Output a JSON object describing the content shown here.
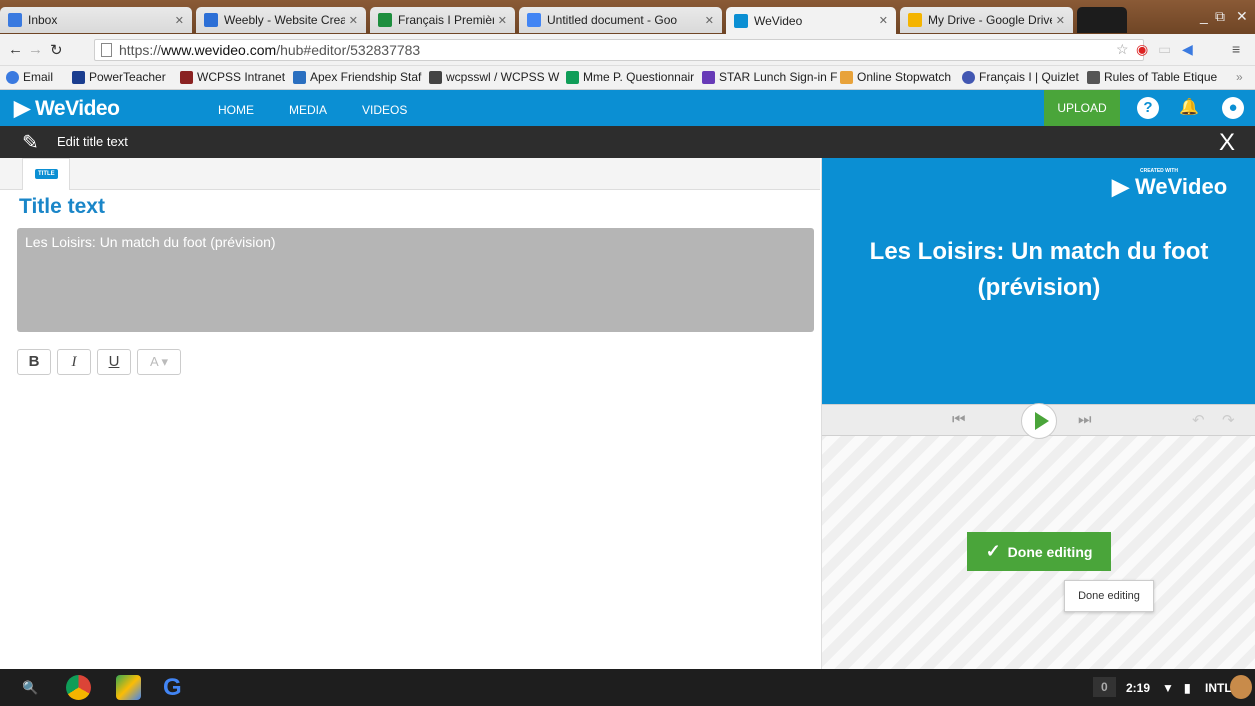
{
  "browser": {
    "tabs": [
      {
        "label": "Inbox",
        "color": "#3a7ae0"
      },
      {
        "label": "Weebly - Website Creati",
        "color": "#2c6fd6"
      },
      {
        "label": "Français I Première",
        "color": "#1e8e3e"
      },
      {
        "label": "Untitled document - Goo",
        "color": "#4285f4"
      },
      {
        "label": "WeVideo",
        "color": "#0b8fd3"
      },
      {
        "label": "My Drive - Google Drive",
        "color": "#f4b400"
      }
    ],
    "url_prefix": "https://",
    "url_host": "www.wevideo.com",
    "url_path": "/hub#editor/532837783",
    "bookmarks": [
      "Email",
      "PowerTeacher",
      "WCPSS Intranet",
      "Apex Friendship Staf",
      "wcpsswl / WCPSS W",
      "Mme P. Questionnair",
      "STAR Lunch Sign-in F",
      "Online Stopwatch",
      "Français I | Quizlet",
      "Rules of Table Etique"
    ]
  },
  "app": {
    "logo": "WeVideo",
    "nav": [
      "HOME",
      "MEDIA",
      "VIDEOS"
    ],
    "upload_label": "UPLOAD",
    "help_label": "?"
  },
  "editbar": {
    "title": "Edit title text",
    "close": "X"
  },
  "editor": {
    "tab_badge": "TITLE",
    "section_title": "Title text",
    "text_value": "Les Loisirs: Un match du foot (prévision)",
    "format_buttons": {
      "bold": "B",
      "italic": "I",
      "underline": "U"
    }
  },
  "preview": {
    "logo_small": "CREATED WITH",
    "logo": "WeVideo",
    "title": "Les Loisirs: Un match du foot (prévision)",
    "done_label": "Done editing",
    "tooltip": "Done editing"
  },
  "shelf": {
    "notif_count": "0",
    "time": "2:19",
    "ime": "INTL"
  }
}
